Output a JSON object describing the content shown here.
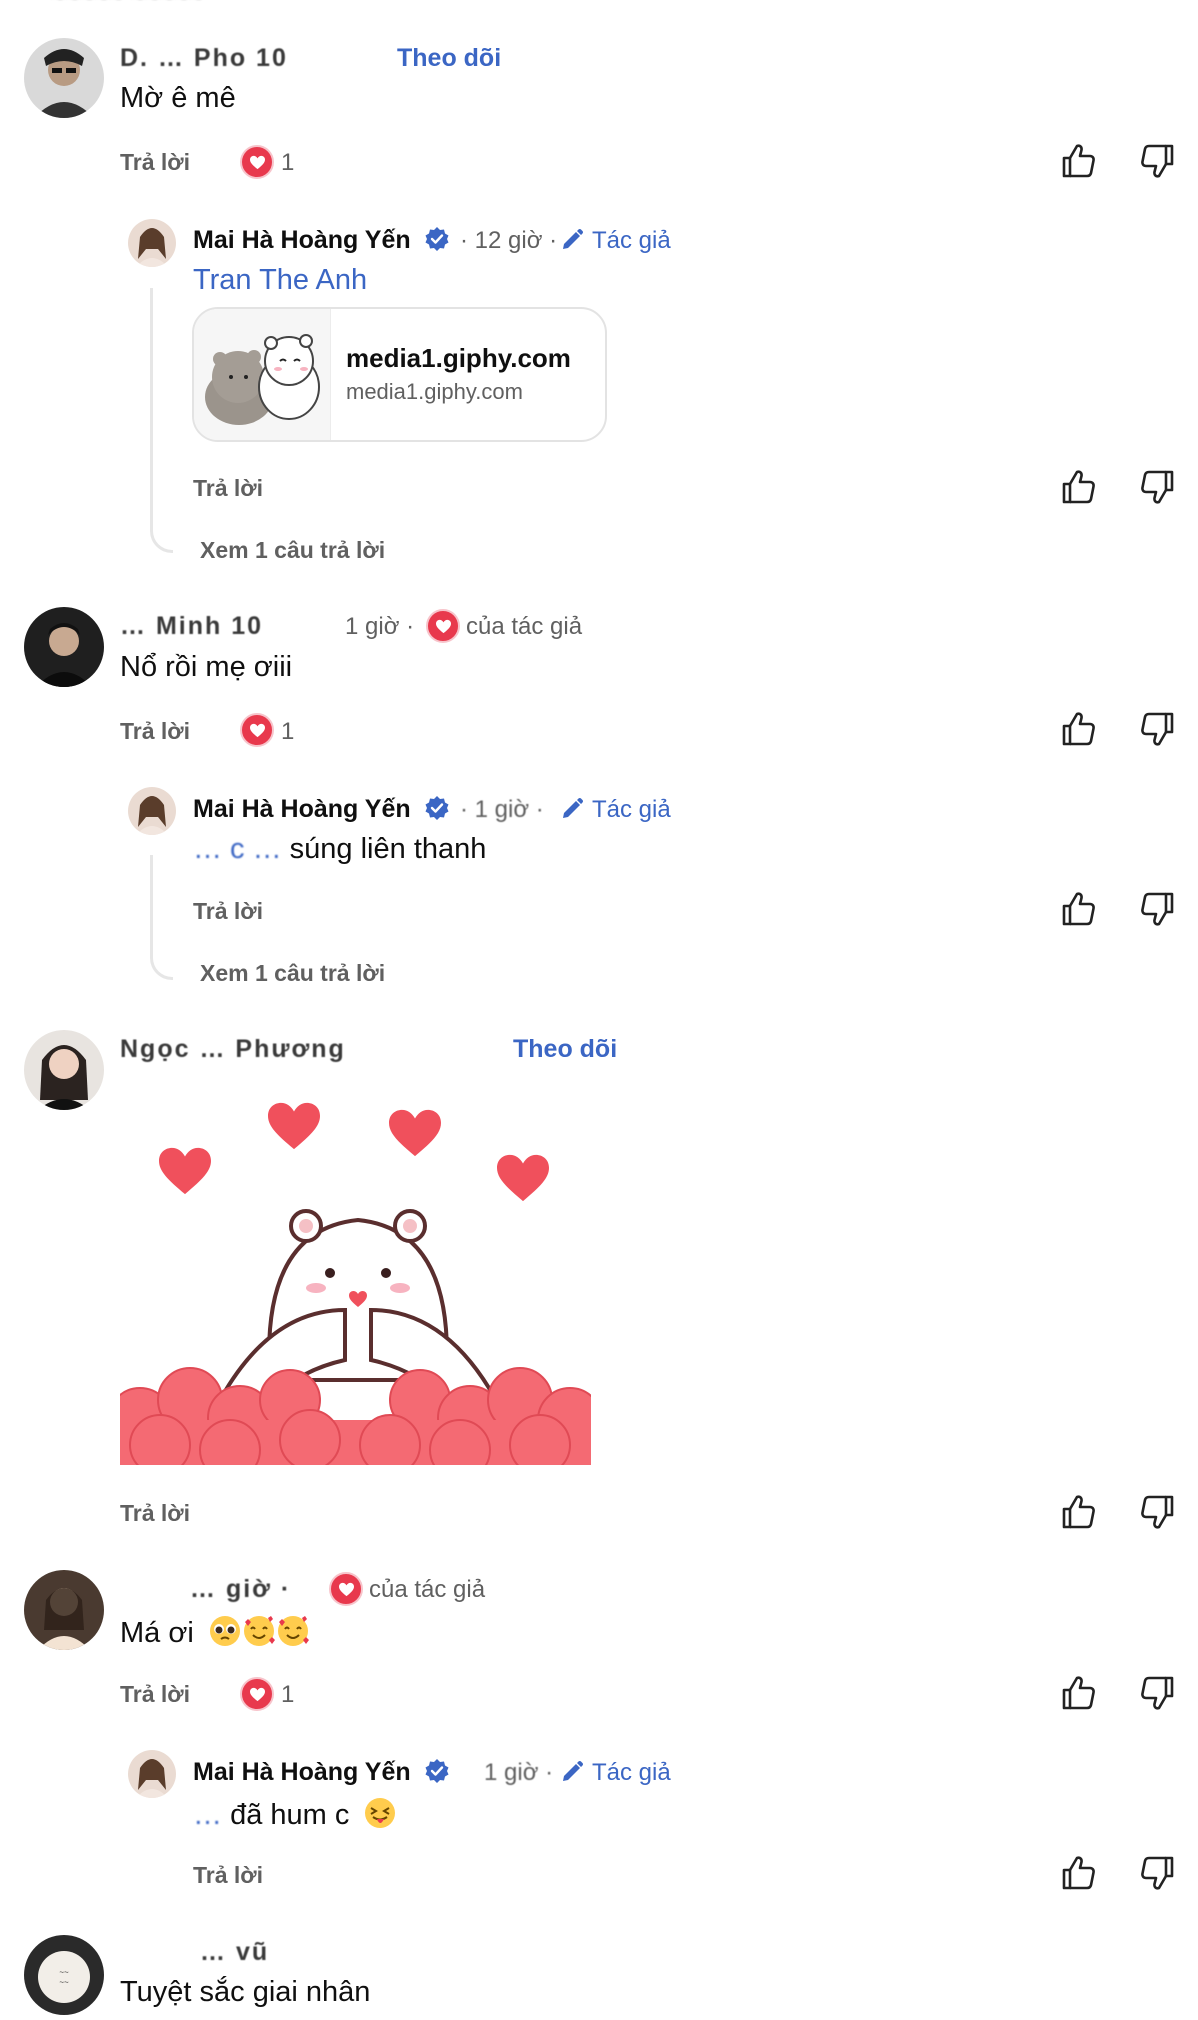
{
  "comments": [
    {
      "name": "D. … Pho 10",
      "follow": "Theo dõi",
      "text": "Mờ ê mê",
      "reply": "Trả lời",
      "likes": "1",
      "replies": [
        {
          "name": "Mai Hà Hoàng Yến",
          "time": "· 12 giờ ·",
          "author_label": "Tác giả",
          "mention": "Tran The Anh",
          "link_title": "media1.giphy.com",
          "link_domain": "media1.giphy.com",
          "reply": "Trả lời",
          "view_more": "Xem 1 câu trả lời"
        }
      ]
    },
    {
      "name": "… Minh 10",
      "time": "1 giờ ·",
      "loved_label": "của tác giả",
      "text": "Nổ rồi mẹ ơiii",
      "reply": "Trả lời",
      "likes": "1",
      "replies": [
        {
          "name": "Mai Hà Hoàng Yến",
          "time": "· 1 giờ ·",
          "author_label": "Tác giả",
          "text_blur": "… c … ",
          "text": "súng liên thanh",
          "reply": "Trả lời",
          "view_more": "Xem 1 câu trả lời"
        }
      ]
    },
    {
      "name": "Ngọc … Phương",
      "follow": "Theo dõi",
      "reply": "Trả lời"
    },
    {
      "name": "… giờ ·",
      "loved_label": "của tác giả",
      "text": "Má ơi",
      "reply": "Trả lời",
      "likes": "1",
      "replies": [
        {
          "name": "Mai Hà Hoàng Yến",
          "time": "1 giờ ·",
          "author_label": "Tác giả",
          "text_blur": "… ",
          "text": "đã hum c",
          "reply": "Trả lời"
        }
      ]
    },
    {
      "name": "… vũ",
      "text": "Tuyệt sắc giai nhân"
    }
  ],
  "colors": {
    "link": "#3b66c4",
    "secondary": "#606060",
    "heart": "#e8394d",
    "verified": "#3b66c4"
  },
  "icons": [
    "thumbs-up-icon",
    "thumbs-down-icon",
    "heart-icon",
    "verified-icon",
    "pencil-icon"
  ]
}
